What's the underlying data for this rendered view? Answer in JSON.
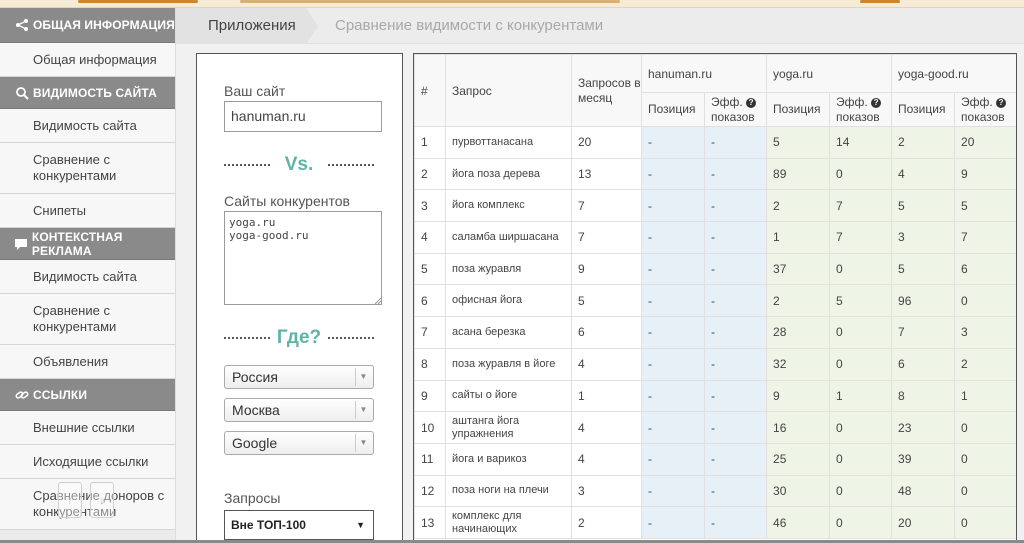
{
  "colors": {
    "sidebar_header": "#8a8a8a",
    "accent_teal": "#5fb3a8",
    "hanuman_col": "#e6f0f6",
    "competitor_col": "#eef5e6"
  },
  "sidebar": {
    "sections": [
      {
        "title": "ОБЩАЯ ИНФОРМАЦИЯ",
        "icon": "share-icon",
        "items": [
          "Общая информация"
        ]
      },
      {
        "title": "ВИДИМОСТЬ САЙТА",
        "icon": "search-icon",
        "items": [
          "Видимость сайта",
          "Сравнение с конкурентами",
          "Снипеты"
        ]
      },
      {
        "title": "КОНТЕКСТНАЯ РЕКЛАМА",
        "icon": "chat-icon",
        "items": [
          "Видимость сайта",
          "Сравнение с конкурентами",
          "Объявления"
        ]
      },
      {
        "title": "ССЫЛКИ",
        "icon": "link-icon",
        "items": [
          "Внешние ссылки",
          "Исходящие ссылки",
          "Сравнение доноров с конкурентами"
        ]
      }
    ]
  },
  "breadcrumb": {
    "first": "Приложения",
    "current": "Сравнение видимости с конкурентами"
  },
  "form": {
    "site_label": "Ваш сайт",
    "site_value": "hanuman.ru",
    "vs_label": "Vs.",
    "competitors_label": "Сайты конкурентов",
    "competitors_value": "yoga.ru\nyoga-good.ru",
    "where_label": "Где?",
    "country": "Россия",
    "city": "Москва",
    "engine": "Google",
    "queries_label": "Запросы",
    "queries_value": "Вне ТОП-100"
  },
  "table": {
    "headers": {
      "num": "#",
      "query": "Запрос",
      "monthly": "Запросов в месяц",
      "sites": [
        "hanuman.ru",
        "yoga.ru",
        "yoga-good.ru"
      ],
      "position": "Позиция",
      "eff": "Эфф.",
      "eff2": "показов"
    },
    "rows": [
      {
        "n": "1",
        "q": "пурвоттанасана",
        "m": "20",
        "v": [
          "-",
          "-",
          "5",
          "14",
          "2",
          "20"
        ]
      },
      {
        "n": "2",
        "q": "йога поза дерева",
        "m": "13",
        "v": [
          "-",
          "-",
          "89",
          "0",
          "4",
          "9"
        ]
      },
      {
        "n": "3",
        "q": "йога комплекс",
        "m": "7",
        "v": [
          "-",
          "-",
          "2",
          "7",
          "5",
          "5"
        ]
      },
      {
        "n": "4",
        "q": "саламба ширшасана",
        "m": "7",
        "v": [
          "-",
          "-",
          "1",
          "7",
          "3",
          "7"
        ]
      },
      {
        "n": "5",
        "q": "поза журавля",
        "m": "9",
        "v": [
          "-",
          "-",
          "37",
          "0",
          "5",
          "6"
        ]
      },
      {
        "n": "6",
        "q": "офисная йога",
        "m": "5",
        "v": [
          "-",
          "-",
          "2",
          "5",
          "96",
          "0"
        ]
      },
      {
        "n": "7",
        "q": "асана березка",
        "m": "6",
        "v": [
          "-",
          "-",
          "28",
          "0",
          "7",
          "3"
        ]
      },
      {
        "n": "8",
        "q": "поза журавля в йоге",
        "m": "4",
        "v": [
          "-",
          "-",
          "32",
          "0",
          "6",
          "2"
        ]
      },
      {
        "n": "9",
        "q": "сайты о йоге",
        "m": "1",
        "v": [
          "-",
          "-",
          "9",
          "1",
          "8",
          "1"
        ]
      },
      {
        "n": "10",
        "q": "аштанга йога упражнения",
        "m": "4",
        "v": [
          "-",
          "-",
          "16",
          "0",
          "23",
          "0"
        ]
      },
      {
        "n": "11",
        "q": "йога и варикоз",
        "m": "4",
        "v": [
          "-",
          "-",
          "25",
          "0",
          "39",
          "0"
        ]
      },
      {
        "n": "12",
        "q": "поза ноги на плечи",
        "m": "3",
        "v": [
          "-",
          "-",
          "30",
          "0",
          "48",
          "0"
        ]
      },
      {
        "n": "13",
        "q": "комплекс для начинающих",
        "m": "2",
        "v": [
          "-",
          "-",
          "46",
          "0",
          "20",
          "0"
        ]
      }
    ]
  }
}
